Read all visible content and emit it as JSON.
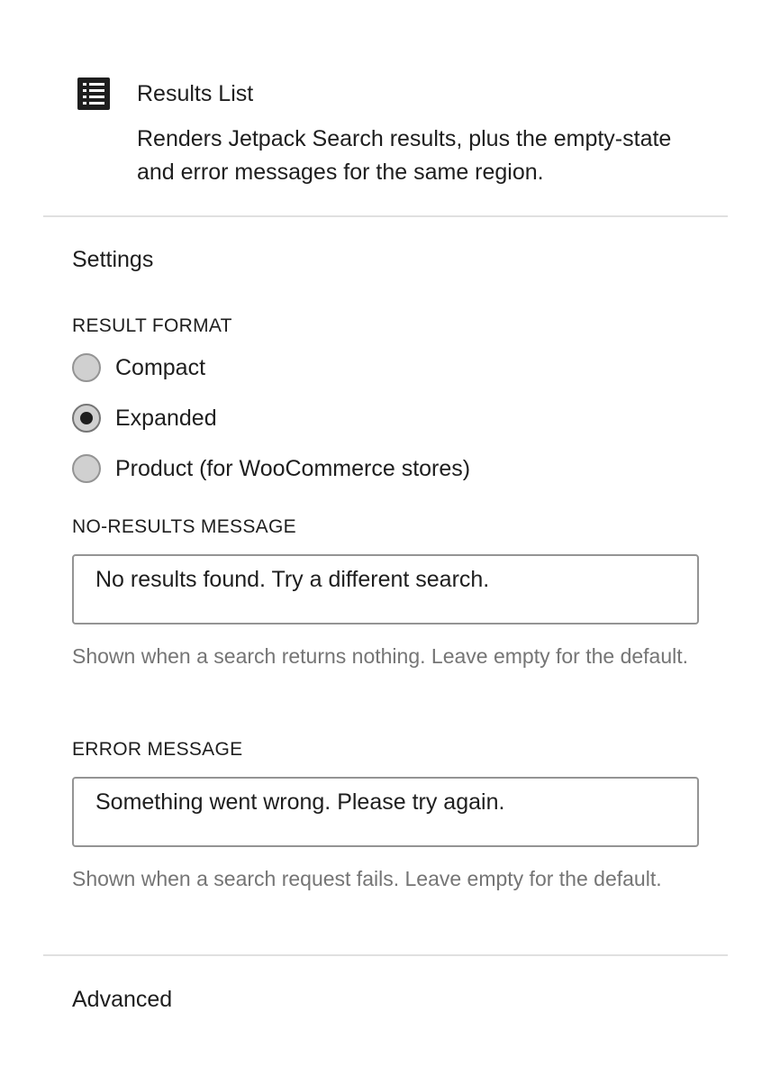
{
  "block": {
    "icon": "list-view-icon",
    "title": "Results List",
    "description": "Renders Jetpack Search results, plus the empty-state and error messages for the same region."
  },
  "settings": {
    "title": "Settings",
    "result_format": {
      "label": "RESULT FORMAT",
      "options": [
        {
          "label": "Compact",
          "checked": false
        },
        {
          "label": "Expanded",
          "checked": true
        },
        {
          "label": "Product (for WooCommerce stores)",
          "checked": false
        }
      ]
    },
    "no_results": {
      "label": "NO-RESULTS MESSAGE",
      "value": "No results found. Try a different search.",
      "help": "Shown when a search returns nothing. Leave empty for the default."
    },
    "error": {
      "label": "ERROR MESSAGE",
      "value": "Something went wrong. Please try again.",
      "help": "Shown when a search request fails. Leave empty for the default."
    }
  },
  "advanced": {
    "title": "Advanced"
  }
}
